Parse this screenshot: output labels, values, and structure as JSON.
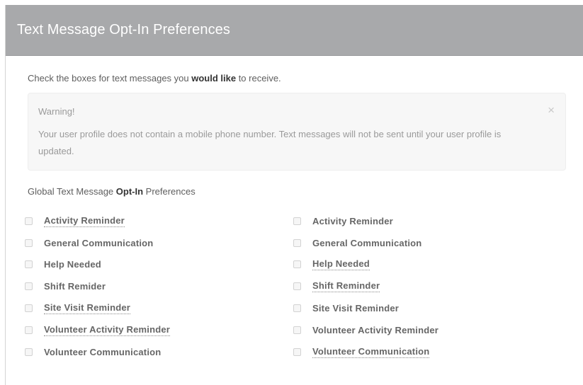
{
  "header": {
    "title": "Text Message Opt-In Preferences"
  },
  "intro": {
    "before": "Check the boxes for text messages you ",
    "bold": "would like",
    "after": " to receive."
  },
  "alert": {
    "title": "Warning!",
    "body": "Your user profile does not contain a mobile phone number. Text messages will not be sent until your user profile is updated.",
    "close": "×"
  },
  "section": {
    "before": "Global Text Message ",
    "bold": "Opt-In",
    "after": " Preferences"
  },
  "left_column": [
    {
      "label": "Activity Reminder",
      "link": true
    },
    {
      "label": "General Communication",
      "link": false
    },
    {
      "label": "Help Needed",
      "link": false
    },
    {
      "label": "Shift Remider",
      "link": false
    },
    {
      "label": "Site Visit Reminder",
      "link": true
    },
    {
      "label": "Volunteer Activity Reminder",
      "link": true
    },
    {
      "label": "Volunteer Communication",
      "link": false
    }
  ],
  "right_column": [
    {
      "label": "Activity Reminder",
      "link": false
    },
    {
      "label": "General Communication",
      "link": false
    },
    {
      "label": "Help Needed",
      "link": true
    },
    {
      "label": "Shift Reminder",
      "link": true
    },
    {
      "label": "Site Visit Reminder",
      "link": false
    },
    {
      "label": "Volunteer Activity Reminder",
      "link": false
    },
    {
      "label": "Volunteer Communication",
      "link": true
    }
  ]
}
